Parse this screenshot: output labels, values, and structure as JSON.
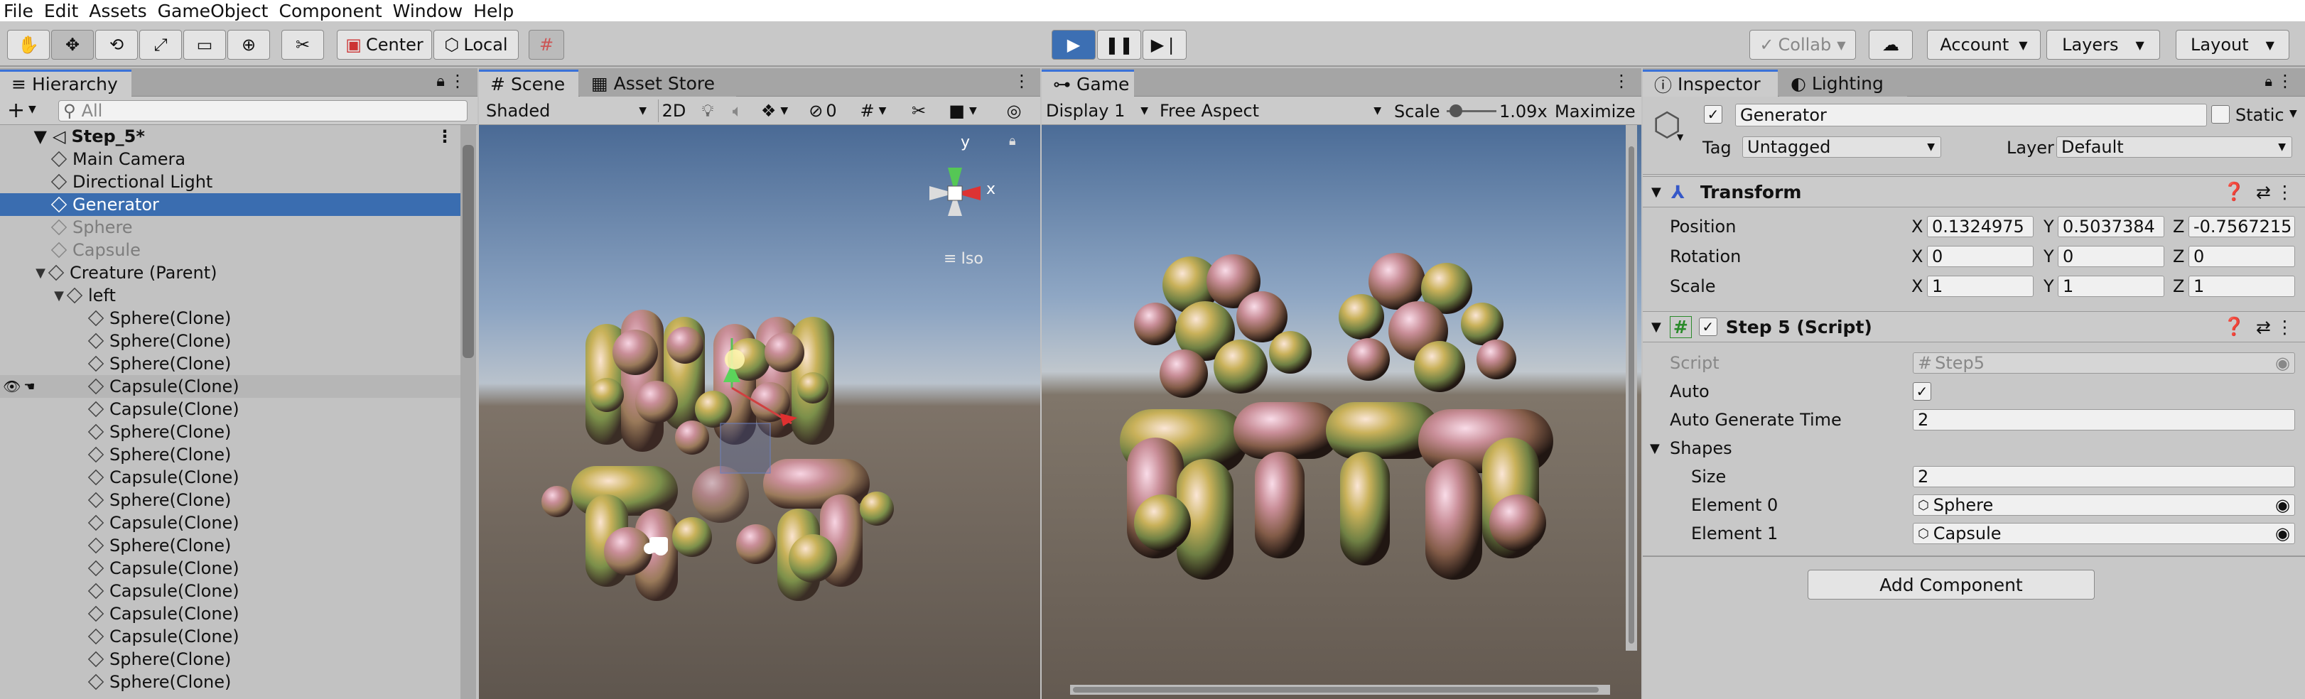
{
  "menu": [
    "File",
    "Edit",
    "Assets",
    "GameObject",
    "Component",
    "Window",
    "Help"
  ],
  "toolbar": {
    "pivot_label": "Center",
    "space_label": "Local",
    "collab_label": "Collab",
    "account_label": "Account",
    "layers_label": "Layers",
    "layout_label": "Layout"
  },
  "hierarchy": {
    "tab": "Hierarchy",
    "search_placeholder": "All",
    "scene_name": "Step_5*",
    "items": [
      {
        "label": "Main Camera",
        "indent": 1,
        "state": ""
      },
      {
        "label": "Directional Light",
        "indent": 1,
        "state": ""
      },
      {
        "label": "Generator",
        "indent": 1,
        "state": "sel"
      },
      {
        "label": "Sphere",
        "indent": 1,
        "state": "dim"
      },
      {
        "label": "Capsule",
        "indent": 1,
        "state": "dim"
      },
      {
        "label": "Creature (Parent)",
        "indent": 1,
        "state": "fold"
      },
      {
        "label": "left",
        "indent": 2,
        "state": "fold"
      },
      {
        "label": "Sphere(Clone)",
        "indent": 3,
        "state": ""
      },
      {
        "label": "Sphere(Clone)",
        "indent": 3,
        "state": ""
      },
      {
        "label": "Sphere(Clone)",
        "indent": 3,
        "state": ""
      },
      {
        "label": "Capsule(Clone)",
        "indent": 3,
        "state": "hov"
      },
      {
        "label": "Capsule(Clone)",
        "indent": 3,
        "state": ""
      },
      {
        "label": "Sphere(Clone)",
        "indent": 3,
        "state": ""
      },
      {
        "label": "Sphere(Clone)",
        "indent": 3,
        "state": ""
      },
      {
        "label": "Capsule(Clone)",
        "indent": 3,
        "state": ""
      },
      {
        "label": "Sphere(Clone)",
        "indent": 3,
        "state": ""
      },
      {
        "label": "Capsule(Clone)",
        "indent": 3,
        "state": ""
      },
      {
        "label": "Sphere(Clone)",
        "indent": 3,
        "state": ""
      },
      {
        "label": "Capsule(Clone)",
        "indent": 3,
        "state": ""
      },
      {
        "label": "Capsule(Clone)",
        "indent": 3,
        "state": ""
      },
      {
        "label": "Capsule(Clone)",
        "indent": 3,
        "state": ""
      },
      {
        "label": "Capsule(Clone)",
        "indent": 3,
        "state": ""
      },
      {
        "label": "Sphere(Clone)",
        "indent": 3,
        "state": ""
      },
      {
        "label": "Sphere(Clone)",
        "indent": 3,
        "state": ""
      }
    ]
  },
  "scene": {
    "tab_scene": "Scene",
    "tab_store": "Asset Store",
    "shading": "Shaded",
    "mode_2d": "2D",
    "gizmo_count": "0",
    "gizmo_x": "x",
    "gizmo_y": "y",
    "projection": "Iso"
  },
  "game": {
    "tab": "Game",
    "display": "Display 1",
    "aspect": "Free Aspect",
    "scale_label": "Scale",
    "scale_value": "1.09x",
    "maximize": "Maximize"
  },
  "inspector": {
    "tab": "Inspector",
    "tab2": "Lighting",
    "object_name": "Generator",
    "static_label": "Static",
    "tag_label": "Tag",
    "tag_value": "Untagged",
    "layer_label": "Layer",
    "layer_value": "Default",
    "transform_title": "Transform",
    "position_label": "Position",
    "rotation_label": "Rotation",
    "scale_label": "Scale",
    "pos": {
      "x": "0.1324975",
      "y": "0.5037384",
      "z": "-0.7567215"
    },
    "rot": {
      "x": "0",
      "y": "0",
      "z": "0"
    },
    "scl": {
      "x": "1",
      "y": "1",
      "z": "1"
    },
    "axis_x": "X",
    "axis_y": "Y",
    "axis_z": "Z",
    "script_title": "Step 5 (Script)",
    "script_label": "Script",
    "script_value": "Step5",
    "auto_label": "Auto",
    "auto_checked": "✓",
    "autotime_label": "Auto Generate Time",
    "autotime_value": "2",
    "shapes_label": "Shapes",
    "size_label": "Size",
    "size_value": "2",
    "el0_label": "Element 0",
    "el0_value": "Sphere",
    "el1_label": "Element 1",
    "el1_value": "Capsule",
    "add_component": "Add Component"
  }
}
